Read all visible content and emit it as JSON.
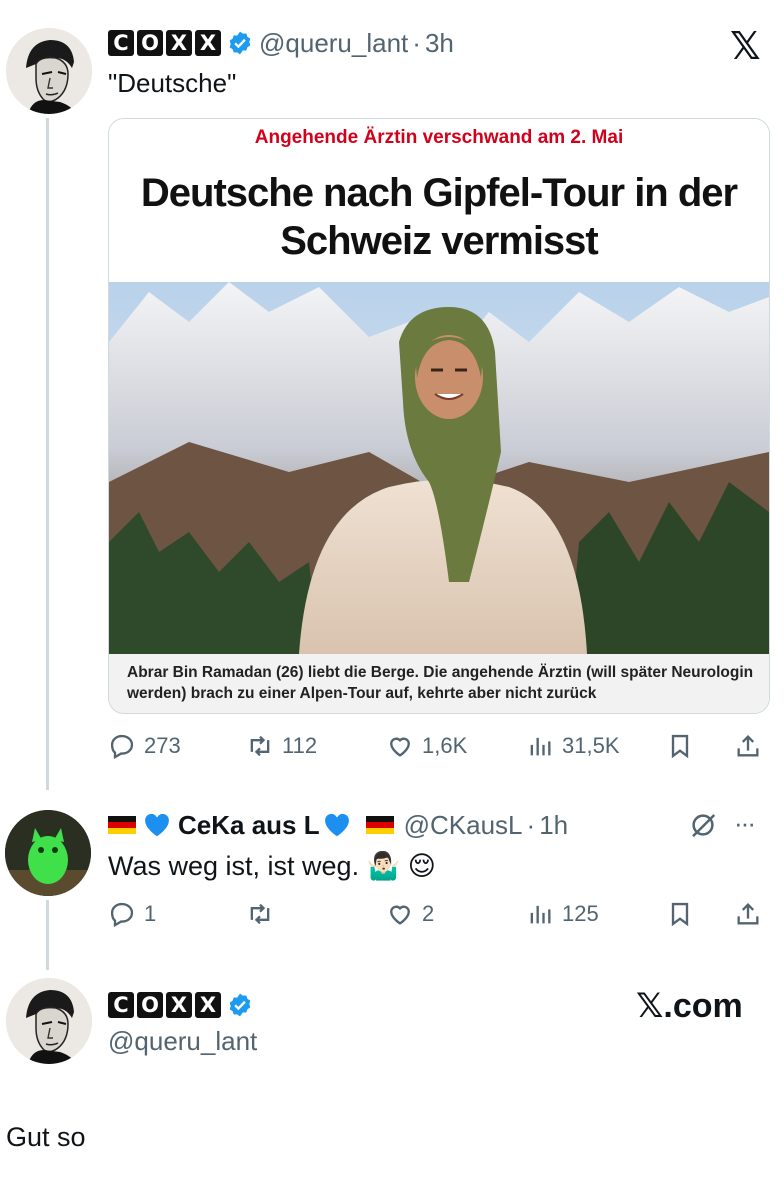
{
  "tweet1": {
    "logo_letters": [
      "C",
      "O",
      "X",
      "X"
    ],
    "handle": "@queru_lant",
    "dot": "·",
    "time": "3h",
    "text": "\"Deutsche\"",
    "close_glyph": "𝕏",
    "card": {
      "kicker": "Angehende Ärztin verschwand am 2. Mai",
      "headline_line1": "Deutsche nach Gipfel-Tour in der",
      "headline_line2": "Schweiz vermisst",
      "caption": "Abrar Bin Ramadan (26) liebt die Berge. Die angehende Ärztin (will später Neurologin werden) brach zu einer Alpen-Tour auf, kehrte aber nicht zurück"
    },
    "stats": {
      "replies": "273",
      "reposts": "112",
      "likes": "1,6K",
      "views": "31,5K"
    }
  },
  "tweet2": {
    "name": "CeKa aus L",
    "handle": "@CKausL",
    "dot": "·",
    "time": "1h",
    "text": "Was weg ist, ist weg.",
    "emoji": "🤷🏻‍♂️ 😌",
    "more": "···",
    "stats": {
      "replies": "1",
      "reposts": "",
      "likes": "2",
      "views": "125"
    }
  },
  "tweet3": {
    "logo_letters": [
      "C",
      "O",
      "X",
      "X"
    ],
    "handle": "@queru_lant",
    "brand": "𝕏.com"
  },
  "footer_text": "Gut so",
  "colors": {
    "accent_blue": "#1d9bf0",
    "muted": "#536471",
    "kicker_red": "#d0021b",
    "line": "#cfd9de"
  },
  "icons": [
    "reply-icon",
    "repost-icon",
    "like-icon",
    "views-icon",
    "bookmark-icon",
    "share-icon",
    "grok-icon",
    "x-logo-icon",
    "verified-badge-icon",
    "blue-heart-icon",
    "german-flag-icon"
  ]
}
